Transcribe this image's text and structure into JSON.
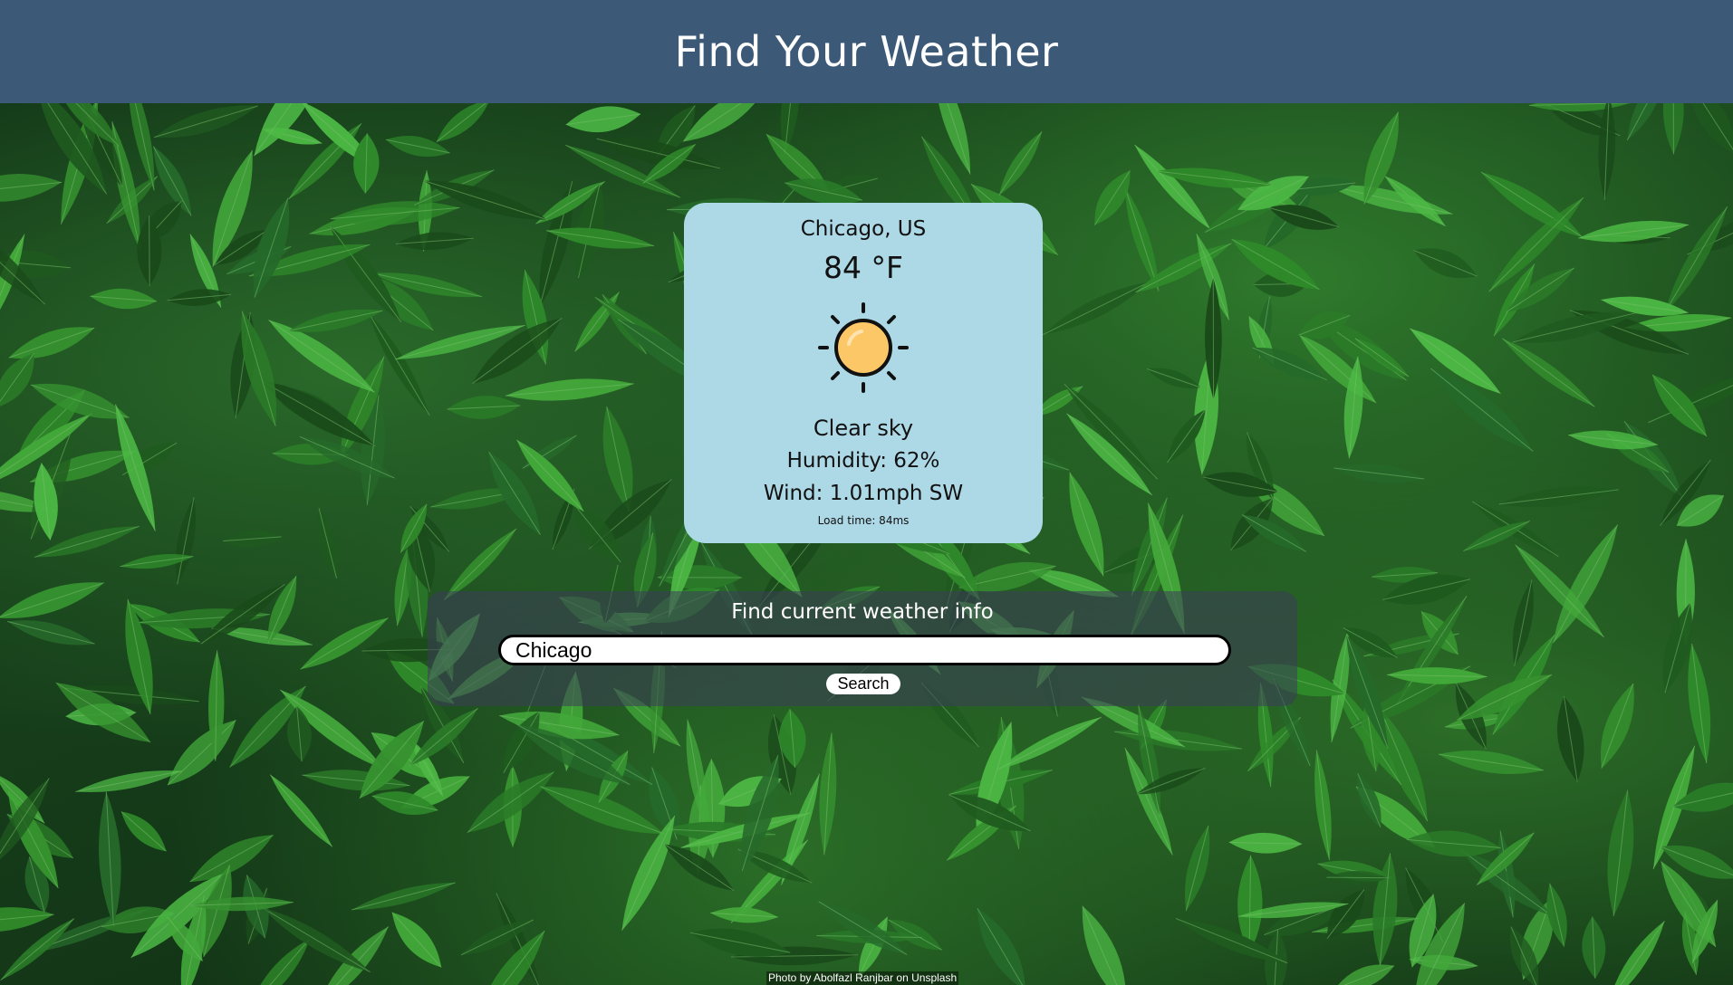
{
  "header": {
    "title": "Find Your Weather"
  },
  "weather": {
    "location": "Chicago, US",
    "temperature": "84 °F",
    "condition_icon": "sun-icon",
    "description": "Clear sky",
    "humidity": "Humidity: 62%",
    "wind": "Wind: 1.01mph SW",
    "load_time": "Load time: 84ms"
  },
  "search": {
    "title": "Find current weather info",
    "input_value": "Chicago",
    "button_label": "Search"
  },
  "footer": {
    "photo_credit": "Photo by Abolfazl Ranjbar on Unsplash"
  },
  "colors": {
    "header_bg": "#3c5a78",
    "card_bg": "#add8e6",
    "sun_fill": "#fcc766"
  }
}
